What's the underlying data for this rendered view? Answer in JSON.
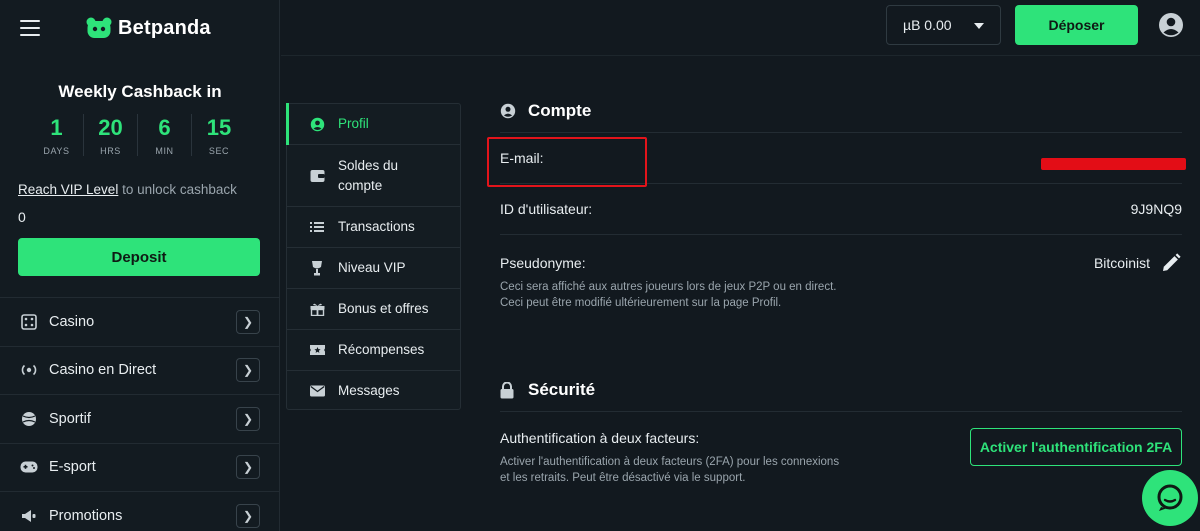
{
  "brand": {
    "name": "Betpanda",
    "accent": "#2ee37a"
  },
  "cashback": {
    "title": "Weekly Cashback in",
    "days": "1",
    "days_label": "DAYS",
    "hrs": "20",
    "hrs_label": "HRS",
    "min": "6",
    "min_label": "MIN",
    "sec": "15",
    "sec_label": "SEC",
    "vip_link": "Reach VIP Level",
    "vip_text": " to unlock cashback",
    "amount": "0",
    "deposit_label": "Deposit"
  },
  "nav": {
    "items": [
      {
        "label": "Casino",
        "icon": "casino-icon"
      },
      {
        "label": "Casino en Direct",
        "icon": "live-icon"
      },
      {
        "label": "Sportif",
        "icon": "sport-ball-icon"
      },
      {
        "label": "E-sport",
        "icon": "gamepad-icon"
      },
      {
        "label": "Promotions",
        "icon": "megaphone-icon"
      }
    ]
  },
  "header": {
    "balance": "µB 0.00",
    "deposit_label": "Déposer"
  },
  "submenu": {
    "items": [
      {
        "label": "Profil",
        "icon": "user-icon",
        "active": true
      },
      {
        "label": "Soldes du compte",
        "icon": "wallet-icon"
      },
      {
        "label": "Transactions",
        "icon": "list-icon"
      },
      {
        "label": "Niveau VIP",
        "icon": "trophy-icon"
      },
      {
        "label": "Bonus et offres",
        "icon": "gift-icon"
      },
      {
        "label": "Récompenses",
        "icon": "ticket-icon"
      },
      {
        "label": "Messages",
        "icon": "mail-icon"
      }
    ]
  },
  "account": {
    "title": "Compte",
    "email_label": "E-mail:",
    "user_id_label": "ID d'utilisateur:",
    "user_id": "9J9NQ9",
    "nickname_label": "Pseudonyme:",
    "nickname": "Bitcoinist",
    "nickname_desc": "Ceci sera affiché aux autres joueurs lors de jeux P2P ou en direct. Ceci peut être modifié ultérieurement sur la page Profil."
  },
  "security": {
    "title": "Sécurité",
    "twofa_label": "Authentification à deux facteurs:",
    "twofa_desc": "Activer l'authentification à deux facteurs (2FA) pour les connexions et les retraits. Peut être désactivé via le support.",
    "twofa_button": "Activer l'authentification 2FA"
  }
}
